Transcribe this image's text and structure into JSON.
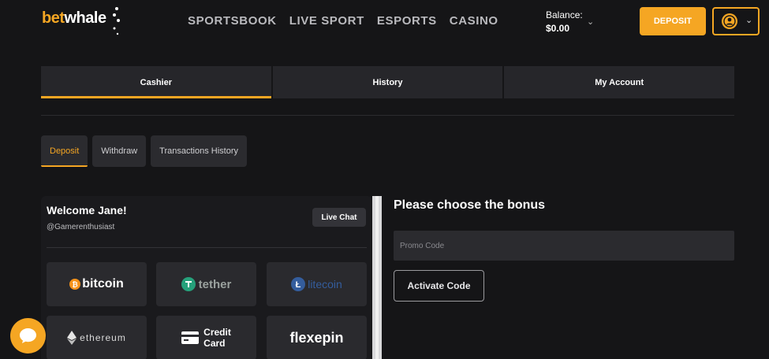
{
  "brand": {
    "part1": "bet",
    "part2": "whale"
  },
  "nav": [
    "SPORTSBOOK",
    "LIVE SPORT",
    "ESPORTS",
    "CASINO"
  ],
  "balance": {
    "label": "Balance:",
    "amount": "$0.00"
  },
  "header": {
    "deposit_label": "DEPOSIT"
  },
  "tabs": [
    "Cashier",
    "History",
    "My Account"
  ],
  "subtabs": [
    "Deposit",
    "Withdraw",
    "Transactions History"
  ],
  "card": {
    "welcome": "Welcome Jane!",
    "handle": "@Gamerenthusiast",
    "live_chat": "Live Chat"
  },
  "payments": {
    "bitcoin": "bitcoin",
    "tether": "tether",
    "litecoin": "litecoin",
    "ethereum": "ethereum",
    "credit_card": "Credit Card",
    "credit_line1": "Credit",
    "credit_line2": "Card",
    "flexepin": "flexepin"
  },
  "bonus": {
    "title": "Please choose the bonus",
    "promo_placeholder": "Promo Code",
    "activate_label": "Activate Code"
  },
  "colors": {
    "accent": "#f5a623",
    "bg": "#151517",
    "panel": "#2a2a2e"
  }
}
